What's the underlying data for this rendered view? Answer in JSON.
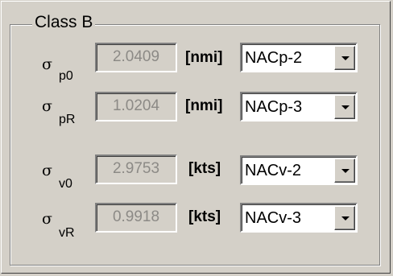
{
  "group": {
    "title": "Class B"
  },
  "rows": [
    {
      "symbol": "σ",
      "subscript": "p0",
      "value": "2.0409",
      "unit": "[nmi]",
      "selected": "NACp-2"
    },
    {
      "symbol": "σ",
      "subscript": "pR",
      "value": "1.0204",
      "unit": "[nmi]",
      "selected": "NACp-3"
    },
    {
      "symbol": "σ",
      "subscript": "v0",
      "value": "2.9753",
      "unit": "[kts]",
      "selected": "NACv-2"
    },
    {
      "symbol": "σ",
      "subscript": "vR",
      "value": "0.9918",
      "unit": "[kts]",
      "selected": "NACv-3"
    }
  ],
  "icons": {
    "dropdown": "chevron-down-icon"
  }
}
